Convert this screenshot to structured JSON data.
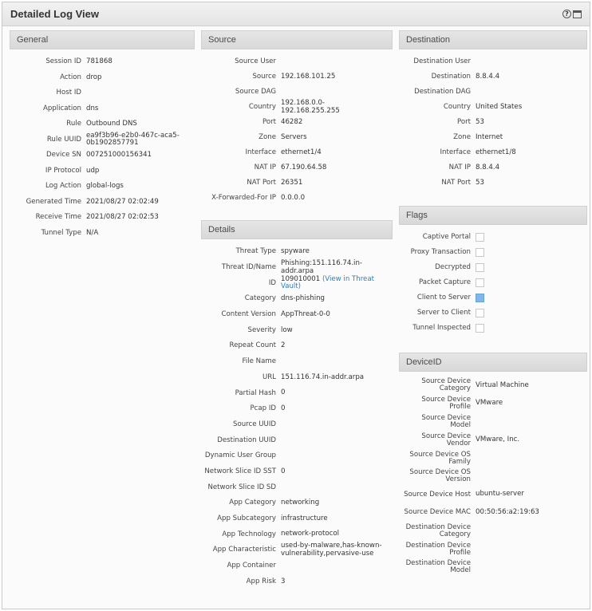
{
  "window": {
    "title": "Detailed Log View",
    "help_icon": "help-icon",
    "maximize_icon": "maximize-icon"
  },
  "general": {
    "header": "General",
    "rows": [
      {
        "label": "Session ID",
        "value": "781868"
      },
      {
        "label": "Action",
        "value": "drop"
      },
      {
        "label": "Host ID",
        "value": ""
      },
      {
        "label": "Application",
        "value": "dns"
      },
      {
        "label": "Rule",
        "value": "Outbound DNS"
      },
      {
        "label": "Rule UUID",
        "value": "ea9f3b96-e2b0-467c-aca5-0b1902857791"
      },
      {
        "label": "Device SN",
        "value": "007251000156341"
      },
      {
        "label": "IP Protocol",
        "value": "udp"
      },
      {
        "label": "Log Action",
        "value": "global-logs"
      },
      {
        "label": "Generated Time",
        "value": "2021/08/27 02:02:49"
      },
      {
        "label": "Receive Time",
        "value": "2021/08/27 02:02:53"
      },
      {
        "label": "Tunnel Type",
        "value": "N/A"
      }
    ]
  },
  "source": {
    "header": "Source",
    "rows": [
      {
        "label": "Source User",
        "value": ""
      },
      {
        "label": "Source",
        "value": "192.168.101.25"
      },
      {
        "label": "Source DAG",
        "value": ""
      },
      {
        "label": "Country",
        "value": "192.168.0.0-192.168.255.255"
      },
      {
        "label": "Port",
        "value": "46282"
      },
      {
        "label": "Zone",
        "value": "Servers"
      },
      {
        "label": "Interface",
        "value": "ethernet1/4"
      },
      {
        "label": "NAT IP",
        "value": "67.190.64.58"
      },
      {
        "label": "NAT Port",
        "value": "26351"
      },
      {
        "label": "X-Forwarded-For IP",
        "value": "0.0.0.0"
      }
    ]
  },
  "destination": {
    "header": "Destination",
    "rows": [
      {
        "label": "Destination User",
        "value": ""
      },
      {
        "label": "Destination",
        "value": "8.8.4.4"
      },
      {
        "label": "Destination DAG",
        "value": ""
      },
      {
        "label": "Country",
        "value": "United States"
      },
      {
        "label": "Port",
        "value": "53"
      },
      {
        "label": "Zone",
        "value": "Internet"
      },
      {
        "label": "Interface",
        "value": "ethernet1/8"
      },
      {
        "label": "NAT IP",
        "value": "8.8.4.4"
      },
      {
        "label": "NAT Port",
        "value": "53"
      }
    ]
  },
  "flags": {
    "header": "Flags",
    "rows": [
      {
        "label": "Captive Portal",
        "checked": false
      },
      {
        "label": "Proxy Transaction",
        "checked": false
      },
      {
        "label": "Decrypted",
        "checked": false
      },
      {
        "label": "Packet Capture",
        "checked": false
      },
      {
        "label": "Client to Server",
        "checked": true
      },
      {
        "label": "Server to Client",
        "checked": false
      },
      {
        "label": "Tunnel Inspected",
        "checked": false
      }
    ]
  },
  "details": {
    "header": "Details",
    "rows": [
      {
        "label": "Threat Type",
        "value": "spyware"
      },
      {
        "label": "Threat ID/Name",
        "value": "Phishing:151.116.74.in-addr.arpa"
      },
      {
        "label": "ID",
        "value": "109010001",
        "link": "(View in Threat Vault)"
      },
      {
        "label": "Category",
        "value": "dns-phishing"
      },
      {
        "label": "Content Version",
        "value": "AppThreat-0-0"
      },
      {
        "label": "Severity",
        "value": "low"
      },
      {
        "label": "Repeat Count",
        "value": "2"
      },
      {
        "label": "File Name",
        "value": ""
      },
      {
        "label": "URL",
        "value": "151.116.74.in-addr.arpa"
      },
      {
        "label": "Partial Hash",
        "value": "0"
      },
      {
        "label": "Pcap ID",
        "value": "0"
      },
      {
        "label": "Source UUID",
        "value": ""
      },
      {
        "label": "Destination UUID",
        "value": ""
      },
      {
        "label": "Dynamic User Group",
        "value": ""
      },
      {
        "label": "Network Slice ID SST",
        "value": "0"
      },
      {
        "label": "Network Slice ID SD",
        "value": ""
      },
      {
        "label": "App Category",
        "value": "networking"
      },
      {
        "label": "App Subcategory",
        "value": "infrastructure"
      },
      {
        "label": "App Technology",
        "value": "network-protocol"
      },
      {
        "label": "App Characteristic",
        "value": "used-by-malware,has-known-vulnerability,pervasive-use"
      },
      {
        "label": "App Container",
        "value": ""
      },
      {
        "label": "App Risk",
        "value": "3"
      }
    ]
  },
  "deviceid": {
    "header": "DeviceID",
    "rows": [
      {
        "label": "Source Device Category",
        "value": "Virtual Machine"
      },
      {
        "label": "Source Device Profile",
        "value": "VMware"
      },
      {
        "label": "Source Device Model",
        "value": ""
      },
      {
        "label": "Source Device Vendor",
        "value": "VMware, Inc."
      },
      {
        "label": "Source Device OS Family",
        "value": ""
      },
      {
        "label": "Source Device OS Version",
        "value": ""
      },
      {
        "label": "Source Device Host",
        "value": "ubuntu-server"
      },
      {
        "label": "Source Device MAC",
        "value": "00:50:56:a2:19:63"
      },
      {
        "label": "Destination Device Category",
        "value": ""
      },
      {
        "label": "Destination Device Profile",
        "value": ""
      },
      {
        "label": "Destination Device Model",
        "value": ""
      }
    ]
  }
}
